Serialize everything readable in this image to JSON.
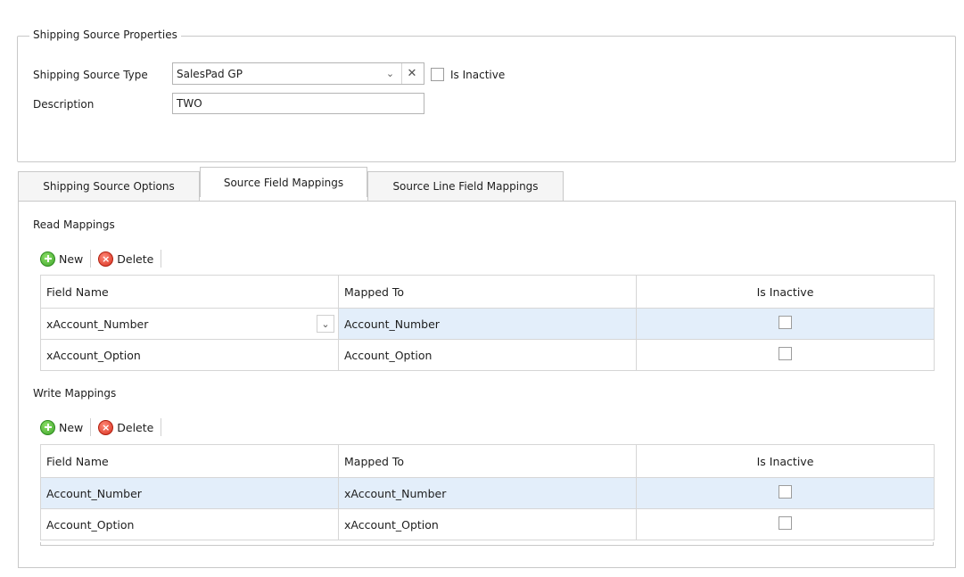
{
  "properties": {
    "legend": "Shipping Source Properties",
    "source_type_label": "Shipping Source Type",
    "source_type_value": "SalesPad GP",
    "is_inactive_label": "Is Inactive",
    "description_label": "Description",
    "description_value": "TWO"
  },
  "tabs": [
    {
      "label": "Shipping Source Options",
      "active": false
    },
    {
      "label": "Source Field Mappings",
      "active": true
    },
    {
      "label": "Source Line Field Mappings",
      "active": false
    }
  ],
  "read_mappings": {
    "title": "Read Mappings",
    "new_label": "New",
    "delete_label": "Delete",
    "columns": [
      "Field Name",
      "Mapped To",
      "Is Inactive"
    ],
    "rows": [
      {
        "field_name": "xAccount_Number",
        "mapped_to": "Account_Number",
        "is_inactive": false
      },
      {
        "field_name": "xAccount_Option",
        "mapped_to": "Account_Option",
        "is_inactive": false
      }
    ]
  },
  "write_mappings": {
    "title": "Write Mappings",
    "new_label": "New",
    "delete_label": "Delete",
    "columns": [
      "Field Name",
      "Mapped To",
      "Is Inactive"
    ],
    "rows": [
      {
        "field_name": "Account_Number",
        "mapped_to": "xAccount_Number",
        "is_inactive": false
      },
      {
        "field_name": "Account_Option",
        "mapped_to": "xAccount_Option",
        "is_inactive": false
      }
    ]
  },
  "colors": {
    "selected_row": "#e3eefa",
    "border": "#c8c8c8",
    "add_icon": "#3ea52a",
    "delete_icon": "#d8301e"
  },
  "icons": {
    "add": "plus-circle-icon",
    "delete": "x-circle-icon",
    "dropdown": "chevron-down-icon",
    "clear": "close-icon"
  }
}
